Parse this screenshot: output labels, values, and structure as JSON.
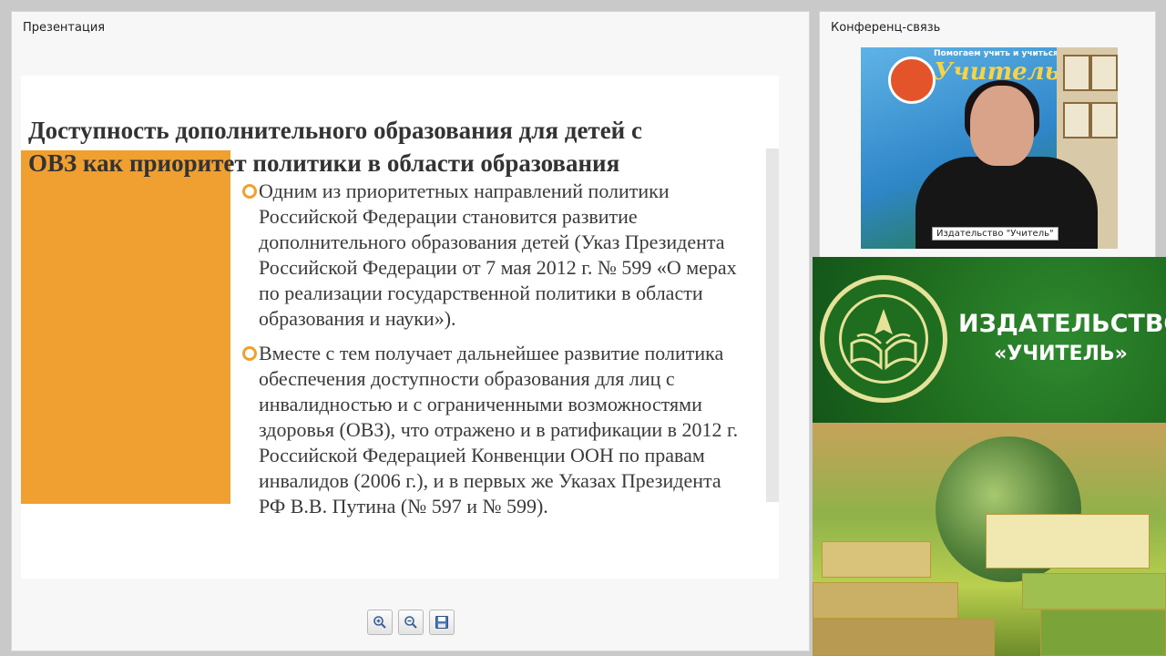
{
  "presentation": {
    "panel_title": "Презентация",
    "slide": {
      "title_line1": "Доступность дополнительного образования  для детей с",
      "title_line2": "ОВЗ как приоритет политики в области образования",
      "bullet1": "Одним из приоритетных направлений политики Российской Федерации становится развитие дополнительного  образования детей (Указ Президента Российской Федерации от 7 мая 2012 г. № 599 «О мерах по реализации государственной политики в области образования и науки»).",
      "bullet2": "Вместе с тем получает дальнейшее развитие политика обеспечения доступности образования для лиц с инвалидностью и с ограниченными возможностями здоровья (ОВЗ), что отражено и в ратификации в 2012 г. Российской Федерацией Конвенции ООН по правам инвалидов (2006 г.), и в первых же Указах Президента РФ В.В. Путина (№ 597 и № 599)."
    },
    "toolbar": {
      "zoom_in_icon": "zoom-in-icon",
      "zoom_out_icon": "zoom-out-icon",
      "save_icon": "save-icon"
    }
  },
  "conference": {
    "panel_title": "Конференц-связь",
    "video_caption": "Издательство \"Учитель\"",
    "board_slogan": "Помогаем учить и учиться",
    "board_brand": "Учитель"
  },
  "publisher_banner": {
    "line1": "ИЗДАТЕЛЬСТВО",
    "line2": "«УЧИТЕЛЬ»"
  },
  "colors": {
    "accent_orange": "#f0a030",
    "banner_green": "#1e6a1e",
    "emblem_gold": "#e7e29a"
  }
}
